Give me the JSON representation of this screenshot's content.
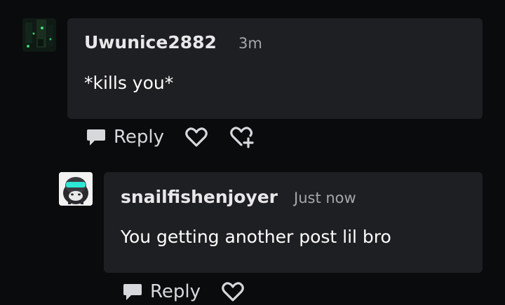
{
  "comments": [
    {
      "username": "Uwunice2882",
      "time": "3m",
      "text": "*kills you*",
      "reply_label": "Reply",
      "actions": [
        "reply-icon",
        "heart-icon",
        "gift-heart-icon"
      ]
    },
    {
      "username": "snailfishenjoyer",
      "time": "Just now",
      "text": "You getting another post lil bro",
      "reply_label": "Reply",
      "actions": [
        "reply-icon",
        "heart-icon"
      ]
    }
  ],
  "colors": {
    "background": "#0a0b0d",
    "bubble": "#1e1f22",
    "muted_text": "#a6a7ab",
    "accent_teal": "#2ee6d6"
  }
}
